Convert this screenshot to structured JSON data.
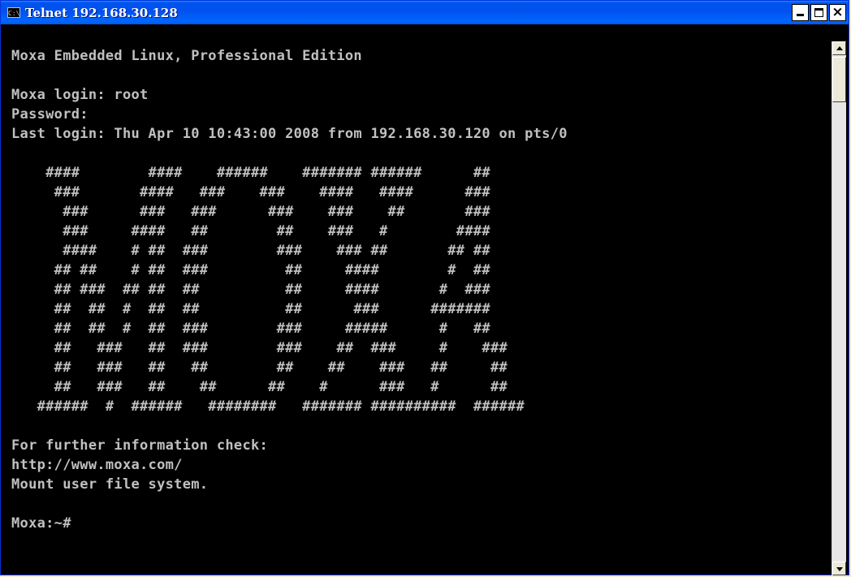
{
  "window": {
    "title": "Telnet 192.168.30.128",
    "icon": "console-icon",
    "icon_text": "C:\\"
  },
  "terminal": {
    "lines": [
      "Moxa Embedded Linux, Professional Edition",
      "",
      "Moxa login: root",
      "Password:",
      "Last login: Thu Apr 10 10:43:00 2008 from 192.168.30.120 on pts/0",
      "",
      "    ####        ####    ######    ####### ######      ##",
      "     ###       ####   ###    ###    ####   ####      ###",
      "      ###      ###   ###      ###    ###    ##       ###",
      "      ###     ####   ##        ##    ###   #        ####",
      "      ####    # ##  ###        ###    ### ##       ## ##",
      "     ## ##    # ##  ###         ##     ####        #  ##",
      "     ## ###  ## ##  ##          ##     ####       #  ###",
      "     ##  ##  #  ##  ##          ##      ###      #######",
      "     ##  ##  #  ##  ###        ###     #####      #   ##",
      "     ##   ###   ##  ###        ###    ##  ###     #    ###",
      "     ##   ###   ##   ##        ##    ##    ###   ##     ##",
      "     ##   ###   ##    ##      ##    #      ###   #      ##",
      "   ######  #  ######   ########   ####### ##########  ######",
      "",
      "For further information check:",
      "http://www.moxa.com/",
      "Mount user file system.",
      "",
      "Moxa:~#"
    ]
  }
}
